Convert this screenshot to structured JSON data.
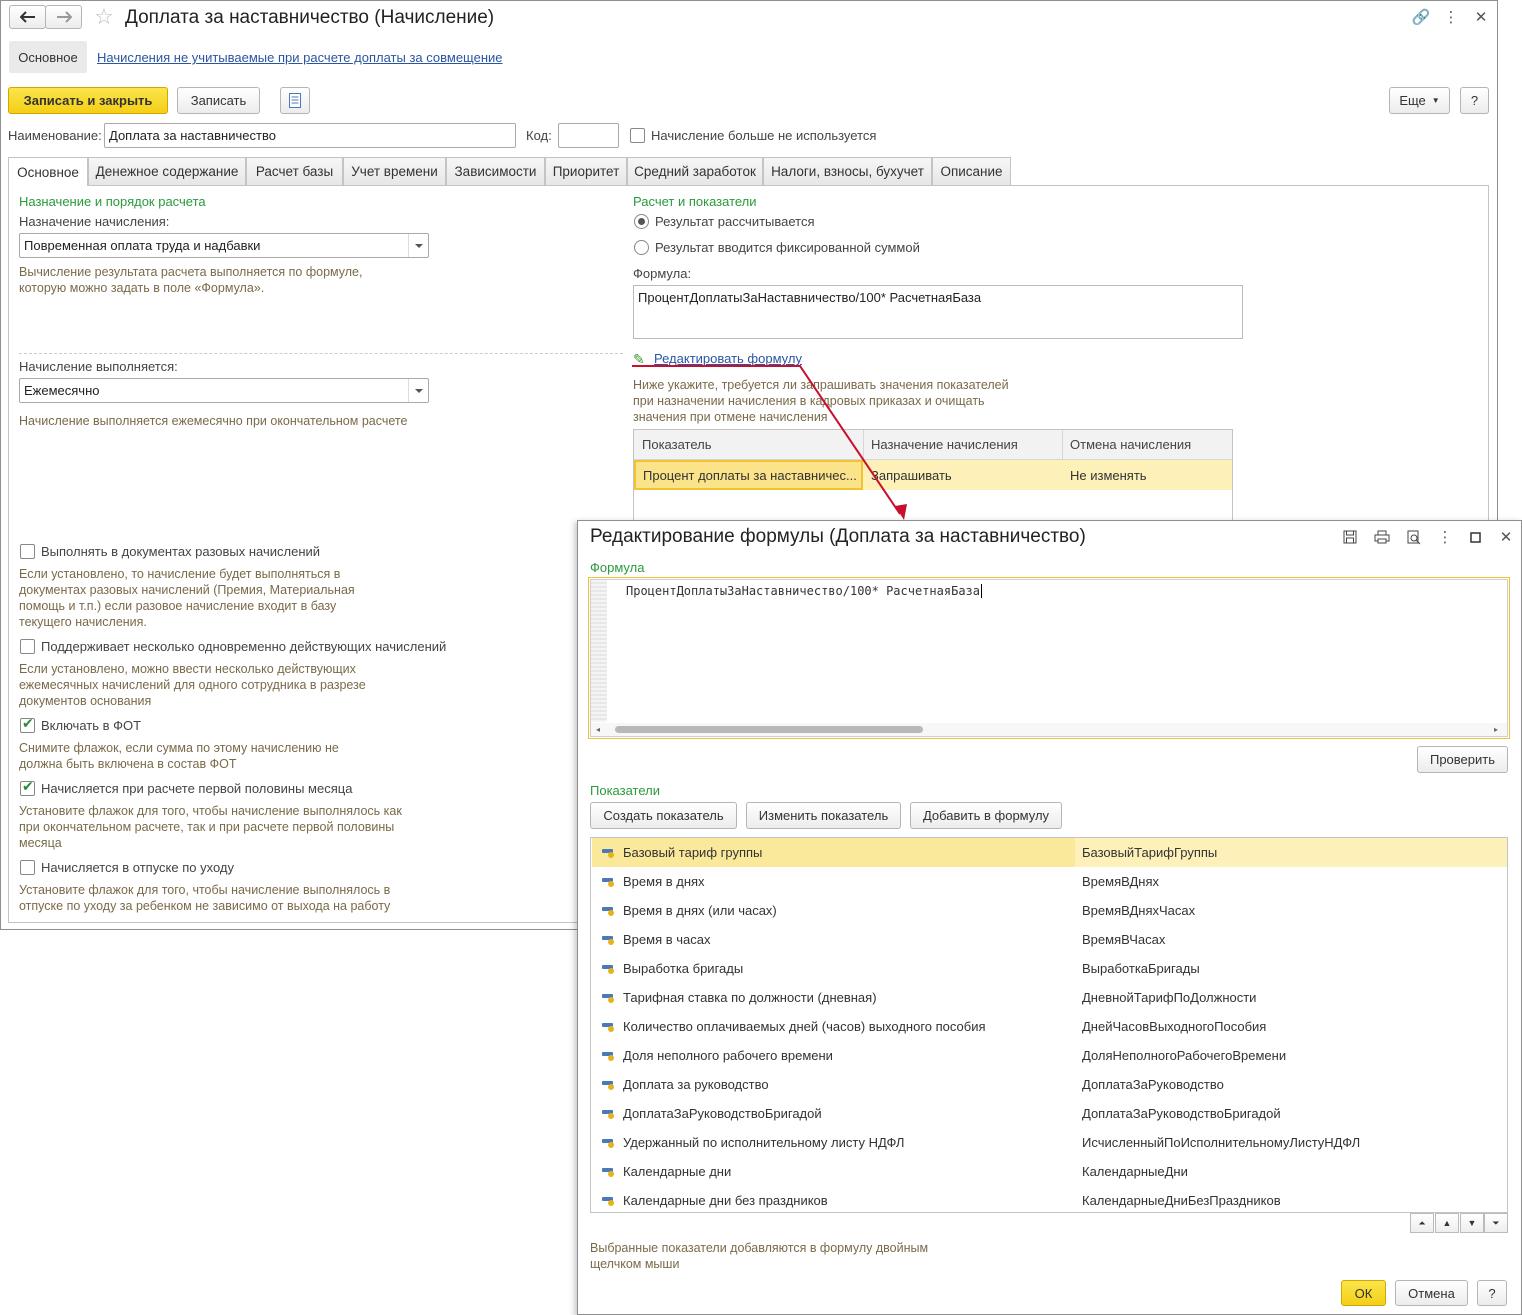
{
  "main": {
    "title": "Доплата за наставничество (Начисление)",
    "nav": {
      "main_label": "Основное",
      "link_label": "Начисления не учитываемые при расчете доплаты за совмещение"
    },
    "toolbar": {
      "save_close": "Записать и закрыть",
      "save": "Записать",
      "more": "Еще",
      "help": "?"
    },
    "name_label": "Наименование:",
    "name_value": "Доплата за наставничество",
    "code_label": "Код:",
    "code_value": "",
    "not_used_label": "Начисление больше не используется",
    "tabs": [
      "Основное",
      "Денежное содержание",
      "Расчет базы",
      "Учет времени",
      "Зависимости",
      "Приоритет",
      "Средний заработок",
      "Налоги, взносы, бухучет",
      "Описание"
    ],
    "left": {
      "section_title": "Назначение и порядок расчета",
      "purpose_label": "Назначение начисления:",
      "purpose_value": "Повременная оплата труда и надбавки",
      "purpose_hint_1": "Вычисление результата расчета выполняется по формуле,",
      "purpose_hint_2": "которую можно задать в поле «Формула».",
      "exec_label": "Начисление выполняется:",
      "exec_value": "Ежемесячно",
      "exec_hint": "Начисление выполняется ежемесячно при окончательном расчете",
      "checks": [
        {
          "label": "Выполнять в документах разовых начислений",
          "checked": false,
          "hint": [
            "Если установлено, то начисление будет выполняться в",
            "документах разовых начислений (Премия, Материальная",
            "помощь и т.п.) если разовое начисление входит в базу",
            "текущего начисления."
          ]
        },
        {
          "label": "Поддерживает несколько одновременно действующих начислений",
          "checked": false,
          "hint": [
            "Если установлено, можно ввести несколько действующих",
            "ежемесячных начислений для одного сотрудника в разрезе",
            "документов основания"
          ]
        },
        {
          "label": "Включать в ФОТ",
          "checked": true,
          "hint": [
            "Снимите флажок, если сумма по этому начислению не",
            "должна быть включена в состав ФОТ"
          ]
        },
        {
          "label": "Начисляется при расчете первой половины месяца",
          "checked": true,
          "hint": [
            "Установите флажок для того, чтобы начисление выполнялось как",
            "при окончательном расчете, так и при расчете первой половины",
            "месяца"
          ]
        },
        {
          "label": "Начисляется в отпуске по уходу",
          "checked": false,
          "hint": [
            "Установите флажок для того, чтобы начисление выполнялось в",
            "отпуске по уходу за ребенком не зависимо от выхода на работу"
          ]
        }
      ]
    },
    "right": {
      "section_title": "Расчет и показатели",
      "radio_calc": "Результат рассчитывается",
      "radio_fixed": "Результат вводится фиксированной суммой",
      "formula_label": "Формула:",
      "formula_value": "ПроцентДоплатыЗаНаставничество/100* РасчетнаяБаза",
      "edit_formula_link": "Редактировать формулу",
      "below_hint": [
        "Ниже укажите, требуется ли запрашивать значения показателей",
        "при назначении начисления в кадровых приказах и очищать",
        "значения при отмене начисления"
      ],
      "grid_headers": [
        "Показатель",
        "Назначение начисления",
        "Отмена начисления"
      ],
      "grid_row": [
        "Процент доплаты за наставничес...",
        "Запрашивать",
        "Не изменять"
      ]
    }
  },
  "dialog": {
    "title": "Редактирование формулы (Доплата за наставничество)",
    "formula_section": "Формула",
    "formula_text": "ПроцентДоплатыЗаНаставничество/100* РасчетнаяБаза",
    "check_button": "Проверить",
    "indicators_section": "Показатели",
    "buttons": {
      "create": "Создать показатель",
      "change": "Изменить показатель",
      "add": "Добавить в формулу"
    },
    "indicators": [
      [
        "Базовый тариф группы",
        "БазовыйТарифГруппы"
      ],
      [
        "Время в днях",
        "ВремяВДнях"
      ],
      [
        "Время в днях (или часах)",
        "ВремяВДняхЧасах"
      ],
      [
        "Время в часах",
        "ВремяВЧасах"
      ],
      [
        "Выработка бригады",
        "ВыработкаБригады"
      ],
      [
        "Тарифная ставка по должности (дневная)",
        "ДневнойТарифПоДолжности"
      ],
      [
        "Количество оплачиваемых дней (часов) выходного пособия",
        "ДнейЧасовВыходногоПособия"
      ],
      [
        "Доля неполного рабочего времени",
        "ДоляНеполногоРабочегоВремени"
      ],
      [
        "Доплата за руководство",
        "ДоплатаЗаРуководство"
      ],
      [
        "ДоплатаЗаРуководствоБригадой",
        "ДоплатаЗаРуководствоБригадой"
      ],
      [
        "Удержанный по исполнительному листу НДФЛ",
        "ИсчисленныйПоИсполнительномуЛистуНДФЛ"
      ],
      [
        "Календарные дни",
        "КалендарныеДни"
      ],
      [
        "Календарные дни без праздников",
        "КалендарныеДниБезПраздников"
      ]
    ],
    "footer_hint": [
      "Выбранные показатели добавляются в формулу двойным",
      "щелчком мыши"
    ],
    "ok": "ОК",
    "cancel": "Отмена",
    "help": "?"
  },
  "colors": {
    "accent_yellow": "#f4cf16",
    "section_green": "#2a9a3b",
    "link_blue": "#2a55a3",
    "arrow_red": "#c8102e"
  }
}
